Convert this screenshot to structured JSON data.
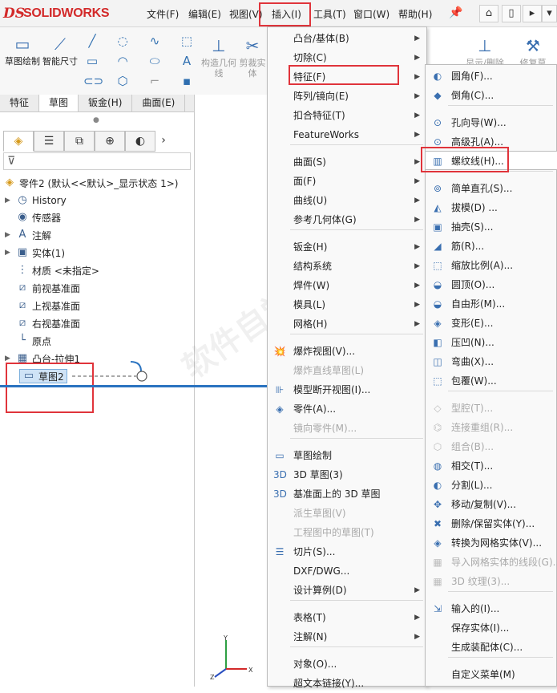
{
  "app": {
    "logo_text": "SOLIDWORKS",
    "logo_mark": "DS"
  },
  "menubar": [
    "文件(F)",
    "编辑(E)",
    "视图(V)",
    "插入(I)",
    "工具(T)",
    "窗口(W)",
    "帮助(H)"
  ],
  "ribbon": {
    "sketch_draw": "草图绘制",
    "smart_dim": "智能尺寸",
    "construct_geom": "构造几何线",
    "trim": "剪裁实体",
    "show_delete": "显示/删除",
    "repair": "修复草"
  },
  "tabs": [
    "特征",
    "草图",
    "钣金(H)",
    "曲面(E)"
  ],
  "tree": {
    "root": "零件2 (默认<<默认>_显示状态 1>)",
    "items": [
      "History",
      "传感器",
      "注解",
      "实体(1)",
      "材质 <未指定>",
      "前视基准面",
      "上视基准面",
      "右视基准面",
      "原点",
      "凸台-拉伸1",
      "草图2"
    ]
  },
  "insert_menu": {
    "items": [
      {
        "label": "凸台/基体(B)",
        "sub": true
      },
      {
        "label": "切除(C)",
        "sub": true
      },
      {
        "label": "特征(F)",
        "sub": true
      },
      {
        "label": "阵列/镜向(E)",
        "sub": true
      },
      {
        "label": "扣合特征(T)",
        "sub": true
      },
      {
        "label": "FeatureWorks",
        "sub": true
      },
      {
        "label": "曲面(S)",
        "sub": true
      },
      {
        "label": "面(F)",
        "sub": true
      },
      {
        "label": "曲线(U)",
        "sub": true
      },
      {
        "label": "参考几何体(G)",
        "sub": true
      },
      {
        "label": "钣金(H)",
        "sub": true
      },
      {
        "label": "结构系统",
        "sub": true
      },
      {
        "label": "焊件(W)",
        "sub": true
      },
      {
        "label": "模具(L)",
        "sub": true
      },
      {
        "label": "网格(H)",
        "sub": true
      },
      {
        "label": "爆炸视图(V)...",
        "sub": false
      },
      {
        "label": "爆炸直线草图(L)",
        "sub": false
      },
      {
        "label": "模型断开视图(I)...",
        "sub": false
      },
      {
        "label": "零件(A)...",
        "sub": false
      },
      {
        "label": "镜向零件(M)...",
        "sub": false
      },
      {
        "label": "草图绘制",
        "sub": false
      },
      {
        "label": "3D 草图(3)",
        "sub": false
      },
      {
        "label": "基准面上的 3D 草图",
        "sub": false
      },
      {
        "label": "派生草图(V)",
        "sub": false
      },
      {
        "label": "工程图中的草图(T)",
        "sub": false
      },
      {
        "label": "切片(S)...",
        "sub": false
      },
      {
        "label": "DXF/DWG...",
        "sub": false
      },
      {
        "label": "设计算例(D)",
        "sub": true
      },
      {
        "label": "表格(T)",
        "sub": true
      },
      {
        "label": "注解(N)",
        "sub": true
      },
      {
        "label": "对象(O)...",
        "sub": false
      },
      {
        "label": "超文本链接(Y)...",
        "sub": false
      }
    ]
  },
  "feature_menu": {
    "items": [
      "圆角(F)...",
      "倒角(C)...",
      "孔向导(W)...",
      "高级孔(A)...",
      "螺纹线(H)...",
      "简单直孔(S)...",
      "拔模(D) ...",
      "抽壳(S)...",
      "筋(R)...",
      "缩放比例(A)...",
      "圆顶(O)...",
      "自由形(M)...",
      "变形(E)...",
      "压凹(N)...",
      "弯曲(X)...",
      "包覆(W)...",
      "型腔(T)...",
      "连接重组(R)...",
      "组合(B)...",
      "相交(T)...",
      "分割(L)...",
      "移动/复制(V)...",
      "删除/保留实体(Y)...",
      "转换为网格实体(V)...",
      "导入网格实体的线段(G)...",
      "3D 纹理(3)...",
      "输入的(I)...",
      "保存实体(I)...",
      "生成装配体(C)...",
      "自定义菜单(M)"
    ]
  },
  "watermark": "软件自学网 RJZXW.COM",
  "axis_labels": {
    "x": "X",
    "y": "Y",
    "z": "Z"
  }
}
